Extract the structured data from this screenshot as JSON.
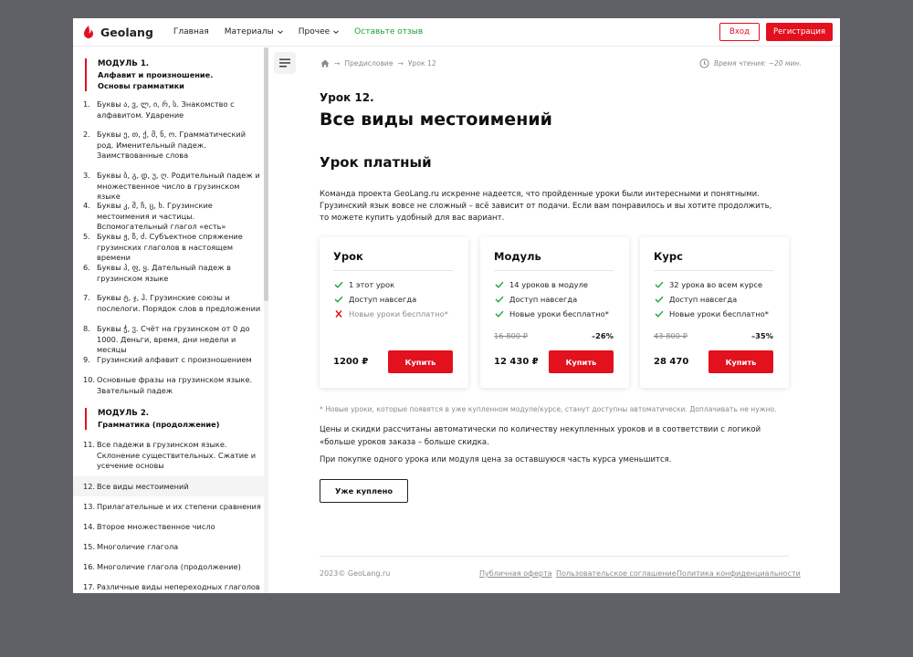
{
  "header": {
    "logo_text": "Geolang",
    "nav": [
      {
        "label": "Главная"
      },
      {
        "label": "Материалы"
      },
      {
        "label": "Прочее"
      },
      {
        "label": "Оставьте отзыв"
      }
    ],
    "login_label": "Вход",
    "register_label": "Регистрация"
  },
  "sidebar": {
    "module1": {
      "title": "МОДУЛЬ 1.",
      "sub1": "Алфавит и произношение.",
      "sub2": "Основы грамматики"
    },
    "module2": {
      "title": "МОДУЛЬ 2.",
      "sub1": "Грамматика (продолжение)"
    },
    "lessons": [
      {
        "num": "1.",
        "text": "Буквы ა, ვ, ლ, ი, რ, ს. Знакомство с алфавитом. Ударение"
      },
      {
        "num": "2.",
        "text": "Буквы ე, თ, ქ, მ, ნ, ო. Грамматический род. Именительный падеж. Заимствованные слова"
      },
      {
        "num": "3.",
        "text": "Буквы ბ, გ, დ, უ, ღ. Родительный падеж и множественное число в грузинском языке"
      },
      {
        "num": "4.",
        "text": "Буквы კ, შ, ჩ, ც, ხ. Грузинские местоимения и частицы. Вспомогательный глагол «есть»"
      },
      {
        "num": "5.",
        "text": "Буквы ჟ, ზ, ძ. Субъектное спряжение грузинских глаголов в настоящем времени"
      },
      {
        "num": "6.",
        "text": "Буквы პ, ფ, ყ. Дательный падеж в грузинском языке"
      },
      {
        "num": "7.",
        "text": "Буквы ტ, ჯ, ჰ. Грузинские союзы и послелоги. Порядок слов в предложении"
      },
      {
        "num": "8.",
        "text": "Буквы ჭ, ჳ. Счёт на грузинском от 0 до 1000. Деньги, время, дни недели и месяцы"
      },
      {
        "num": "9.",
        "text": "Грузинский алфавит с произношением"
      },
      {
        "num": "10.",
        "text": "Основные фразы на грузинском языке. Звательный падеж"
      },
      {
        "num": "11.",
        "text": "Все падежи в грузинском языке. Склонение существительных. Сжатие и усечение основы"
      },
      {
        "num": "12.",
        "text": "Все виды местоимений"
      },
      {
        "num": "13.",
        "text": "Прилагательные и их степени сравнения"
      },
      {
        "num": "14.",
        "text": "Второе множественное число"
      },
      {
        "num": "15.",
        "text": "Многоличие глагола"
      },
      {
        "num": "16.",
        "text": "Многоличие глагола (продолжение)"
      },
      {
        "num": "17.",
        "text": "Различные виды непереходных глаголов"
      }
    ]
  },
  "breadcrumb": {
    "sep": "→",
    "item1": "Предисловие",
    "item2": "Урок 12"
  },
  "read_time": "Время чтения: ~20 мин.",
  "lesson_no": "Урок 12.",
  "title": "Все виды местоимений",
  "section_title": "Урок платный",
  "intro": "Команда проекта GeoLang.ru искренне надеется, что пройденные уроки были интересными и понятными. Грузинский язык вовсе не сложный – всё зависит от подачи. Если вам понравилось и вы хотите продолжить, то можете купить удобный для вас вариант.",
  "cards": [
    {
      "title": "Урок",
      "features": [
        {
          "text": "1 этот урок",
          "ok": true
        },
        {
          "text": "Доступ навсегда",
          "ok": true
        },
        {
          "text": "Новые уроки бесплатно*",
          "ok": false
        }
      ],
      "old": "",
      "discount": "",
      "price": "1200 ₽",
      "buy": "Купить"
    },
    {
      "title": "Модуль",
      "features": [
        {
          "text": "14 уроков в модуле",
          "ok": true
        },
        {
          "text": "Доступ навсегда",
          "ok": true
        },
        {
          "text": "Новые уроки бесплатно*",
          "ok": true
        }
      ],
      "old": "16 800 ₽",
      "discount": "–26%",
      "price": "12 430 ₽",
      "buy": "Купить"
    },
    {
      "title": "Курс",
      "features": [
        {
          "text": "32 урока во всем курсе",
          "ok": true
        },
        {
          "text": "Доступ навсегда",
          "ok": true
        },
        {
          "text": "Новые уроки бесплатно*",
          "ok": true
        }
      ],
      "old": "43 800 ₽",
      "discount": "–35%",
      "price": "28 470",
      "buy": "Купить"
    }
  ],
  "note": "* Новые уроки, которые появятся в уже купленном модуле/курсе, станут доступны автоматически. Доплачивать не нужно.",
  "para1": "Цены и скидки рассчитаны автоматически по количеству некупленных уроков и в соответствии с логикой «больше уроков заказа – больше скидка.",
  "para2": "При покупке одного урока или модуля цена за оставшуюся часть курса уменьшится.",
  "bought_label": "Уже куплено",
  "footer": {
    "copyright": "2023© GeoLang.ru",
    "links": [
      {
        "label": "Публичная оферта"
      },
      {
        "label": "Пользовательское соглашение"
      },
      {
        "label": "Политика конфиденциальности"
      }
    ]
  },
  "colors": {
    "accent": "#e3101e",
    "green": "#1aa13a",
    "muted": "#8a8a8a"
  },
  "icons": {
    "logo": "geolang-logo-icon",
    "chevron": "chevron-down-icon",
    "menu": "menu-icon",
    "home": "home-icon",
    "clock": "clock-icon",
    "check": "check-icon",
    "cross": "cross-icon"
  }
}
